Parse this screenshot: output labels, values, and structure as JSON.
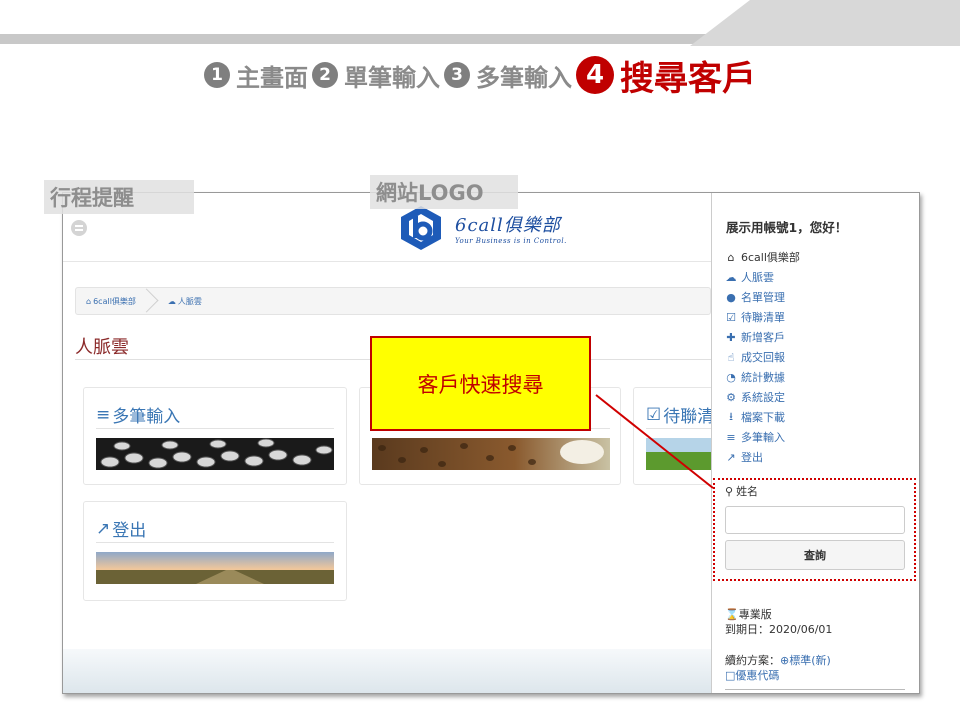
{
  "steps": [
    {
      "num": "1",
      "label": "主畫面"
    },
    {
      "num": "2",
      "label": "單筆輸入"
    },
    {
      "num": "3",
      "label": "多筆輸入"
    },
    {
      "num": "4",
      "label": "搜尋客戶"
    }
  ],
  "overlay_labels": {
    "reminder": "行程提醒",
    "logo": "網站LOGO",
    "callout": "客戶快速搜尋"
  },
  "app": {
    "brand_name": "6call俱樂部",
    "tagline": "Your Business is in Control.",
    "breadcrumb": [
      "6call俱樂部",
      "人脈雲"
    ],
    "page_title": "人脈雲",
    "cards": [
      {
        "label": "多筆輸入",
        "icon": "list-ol-icon"
      },
      {
        "label": "",
        "icon": ""
      },
      {
        "label": "待聯清",
        "icon": "calendar-check-icon"
      },
      {
        "label": "登出",
        "icon": "external-link-icon"
      }
    ]
  },
  "sidebar": {
    "greeting": "展示用帳號1，您好！",
    "menu": [
      {
        "label": "6call俱樂部",
        "icon": "home-icon"
      },
      {
        "label": "人脈雲",
        "icon": "cloud-icon"
      },
      {
        "label": "名單管理",
        "icon": "users-icon"
      },
      {
        "label": "待聯清單",
        "icon": "calendar-check-icon"
      },
      {
        "label": "新增客戶",
        "icon": "user-plus-icon"
      },
      {
        "label": "成交回報",
        "icon": "thumbs-up-icon"
      },
      {
        "label": "統計數據",
        "icon": "pie-chart-icon"
      },
      {
        "label": "系統設定",
        "icon": "gears-icon"
      },
      {
        "label": "檔案下載",
        "icon": "download-icon"
      },
      {
        "label": "多筆輸入",
        "icon": "list-ol-icon"
      },
      {
        "label": "登出",
        "icon": "external-link-icon"
      }
    ],
    "search": {
      "label": "姓名",
      "value": "",
      "placeholder": "",
      "button": "查詢"
    },
    "plan": {
      "edition": "專業版",
      "expiry_label": "到期日：",
      "expiry_date": "2020/06/01"
    },
    "renew": {
      "label": "續約方案：",
      "standard": "標準(新)",
      "coupon": "優惠代碼"
    }
  },
  "colors": {
    "accent_red": "#c00000",
    "link_blue": "#3a6fb0",
    "callout_yellow": "#ffff00",
    "title_maroon": "#8b2a2a"
  }
}
